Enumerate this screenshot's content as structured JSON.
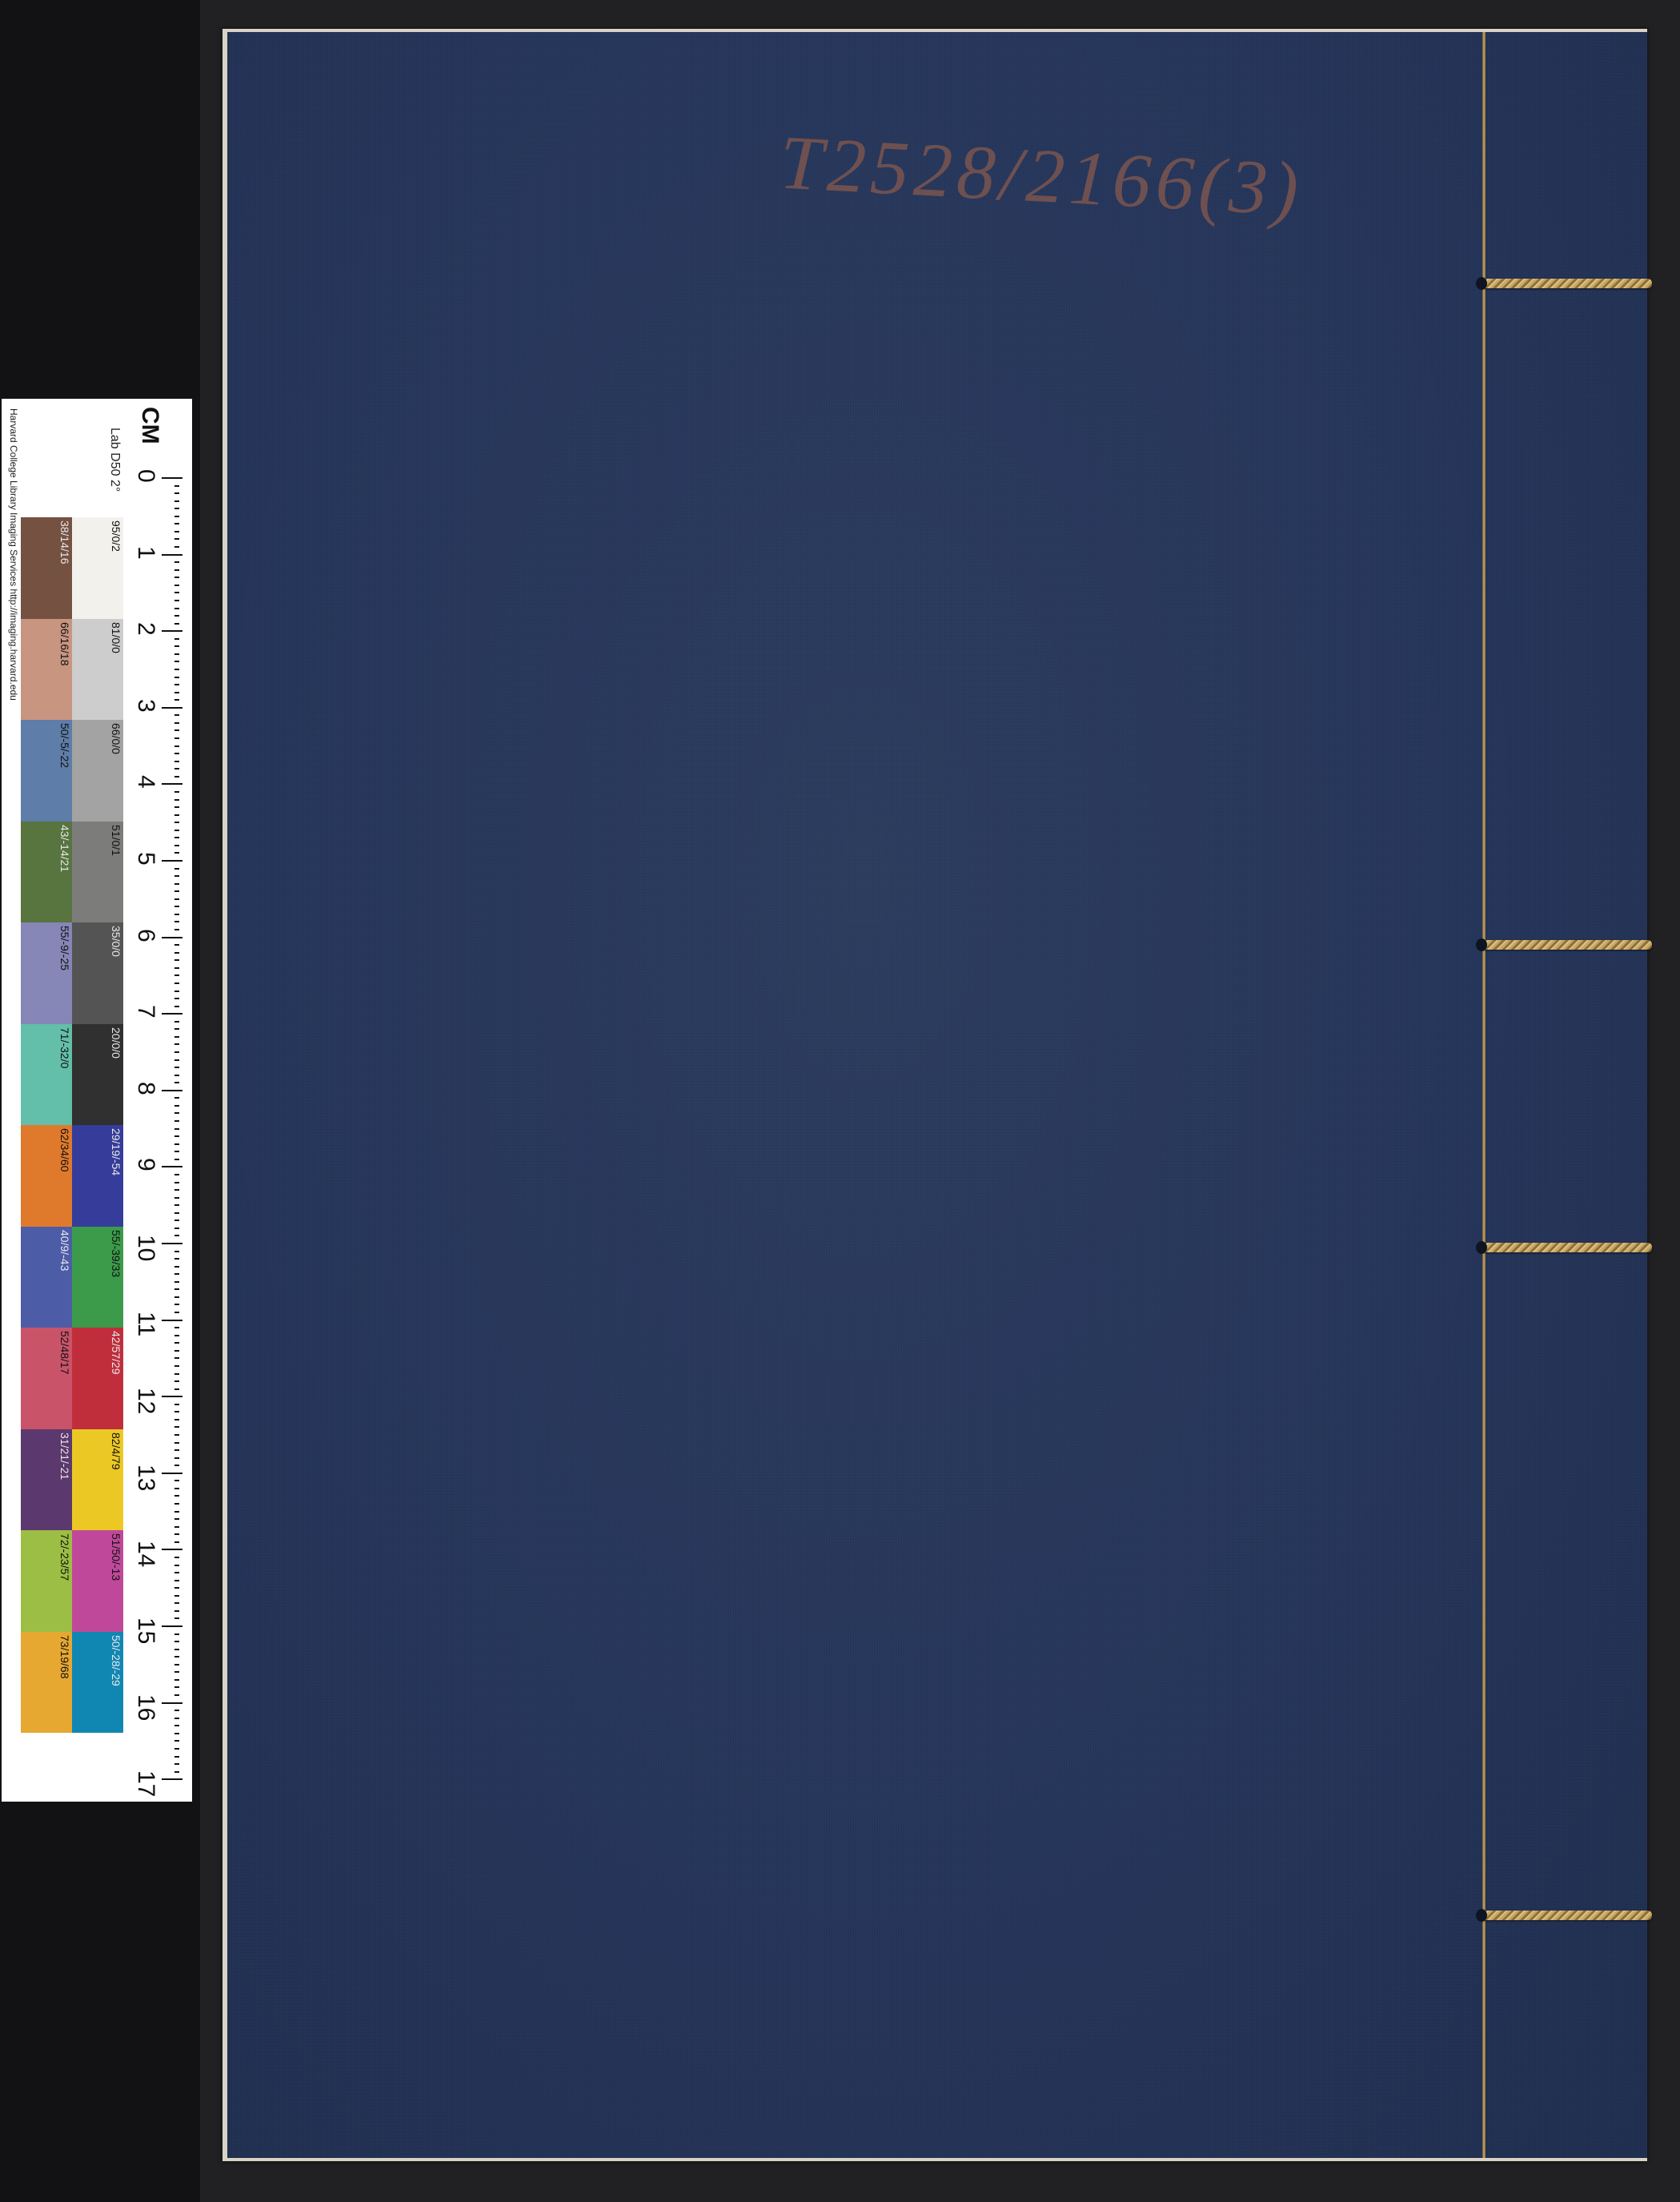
{
  "call_number": "T2528/2166(3)",
  "target": {
    "unit": "CM",
    "reference": "Lab D50 2°",
    "credit": "Harvard College Library Imaging Services http://imaging.harvard.edu",
    "scale_numbers": [
      "0",
      "1",
      "2",
      "3",
      "4",
      "5",
      "6",
      "7",
      "8",
      "9",
      "10",
      "11",
      "12",
      "13",
      "14",
      "15",
      "16",
      "17"
    ],
    "gray_column": [
      {
        "label": "95/0/2",
        "color": "#f3f1ec"
      },
      {
        "label": "81/0/0",
        "color": "#cdcdcd"
      },
      {
        "label": "66/0/0",
        "color": "#a3a3a3"
      },
      {
        "label": "51/0/1",
        "color": "#7c7c7b"
      },
      {
        "label": "35/0/0",
        "color": "#545454"
      },
      {
        "label": "20/0/0",
        "color": "#303030"
      },
      {
        "label": "29/19/-54",
        "color": "#353c9a"
      },
      {
        "label": "55/-39/33",
        "color": "#3b9b4a"
      },
      {
        "label": "42/57/29",
        "color": "#c02e3c"
      },
      {
        "label": "82/4/79",
        "color": "#ecc825"
      },
      {
        "label": "51/50/-13",
        "color": "#c0489a"
      },
      {
        "label": "50/-28/-29",
        "color": "#1087b3"
      }
    ],
    "color_column": [
      {
        "label": "38/14/16",
        "color": "#755142"
      },
      {
        "label": "66/16/18",
        "color": "#c89581"
      },
      {
        "label": "50/-5/-22",
        "color": "#5e7da8"
      },
      {
        "label": "43/-14/21",
        "color": "#58743f"
      },
      {
        "label": "55/-9/-25",
        "color": "#8686b7"
      },
      {
        "label": "71/-32/0",
        "color": "#63bfa9"
      },
      {
        "label": "62/34/60",
        "color": "#df7a2d"
      },
      {
        "label": "40/9/-43",
        "color": "#4d5ca7"
      },
      {
        "label": "52/48/17",
        "color": "#c9546a"
      },
      {
        "label": "31/21/-21",
        "color": "#5b386d"
      },
      {
        "label": "72/-23/57",
        "color": "#9cbe44"
      },
      {
        "label": "73/19/68",
        "color": "#e6a831"
      }
    ]
  },
  "colors": {
    "cover": "#25355a",
    "thread": "#c9a662",
    "backdrop": "#1b1b1d"
  }
}
